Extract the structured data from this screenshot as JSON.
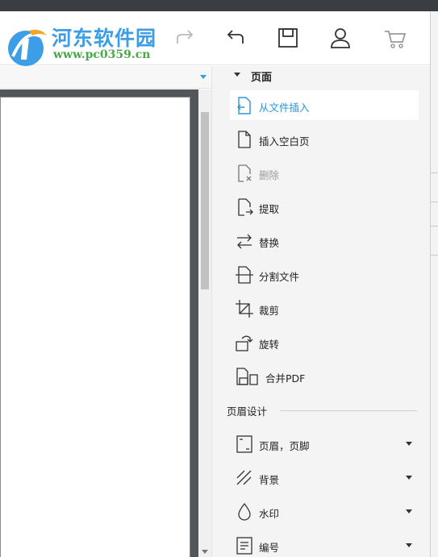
{
  "watermark": {
    "name": "河东软件园",
    "url": "www.pc0359.cn"
  },
  "toolbar": {
    "buttons": [
      {
        "name": "redo",
        "icon": "redo-icon"
      },
      {
        "name": "undo",
        "icon": "undo-icon"
      },
      {
        "name": "save",
        "icon": "save-icon"
      },
      {
        "name": "account",
        "icon": "user-icon"
      },
      {
        "name": "cart",
        "icon": "cart-icon"
      }
    ]
  },
  "panel": {
    "section_title": "页面",
    "items": [
      {
        "label": "从文件插入",
        "icon": "insert-from-file-icon",
        "state": "active"
      },
      {
        "label": "插入空白页",
        "icon": "blank-page-icon",
        "state": "normal"
      },
      {
        "label": "删除",
        "icon": "delete-page-icon",
        "state": "disabled"
      },
      {
        "label": "提取",
        "icon": "extract-page-icon",
        "state": "normal"
      },
      {
        "label": "替换",
        "icon": "replace-icon",
        "state": "normal"
      },
      {
        "label": "分割文件",
        "icon": "split-file-icon",
        "state": "normal"
      },
      {
        "label": "裁剪",
        "icon": "crop-icon",
        "state": "normal"
      },
      {
        "label": "旋转",
        "icon": "rotate-icon",
        "state": "normal"
      },
      {
        "label": "合并PDF",
        "icon": "merge-pdf-icon",
        "state": "normal"
      }
    ],
    "group_title": "页眉设计",
    "group_items": [
      {
        "label": "页眉，页脚",
        "icon": "header-footer-icon"
      },
      {
        "label": "背景",
        "icon": "background-icon"
      },
      {
        "label": "水印",
        "icon": "watermark-drop-icon"
      },
      {
        "label": "编号",
        "icon": "numbering-icon"
      }
    ]
  },
  "colors": {
    "accent": "#2a95d6",
    "panel_bg": "#f4f4f5",
    "doc_bg": "#525659"
  }
}
